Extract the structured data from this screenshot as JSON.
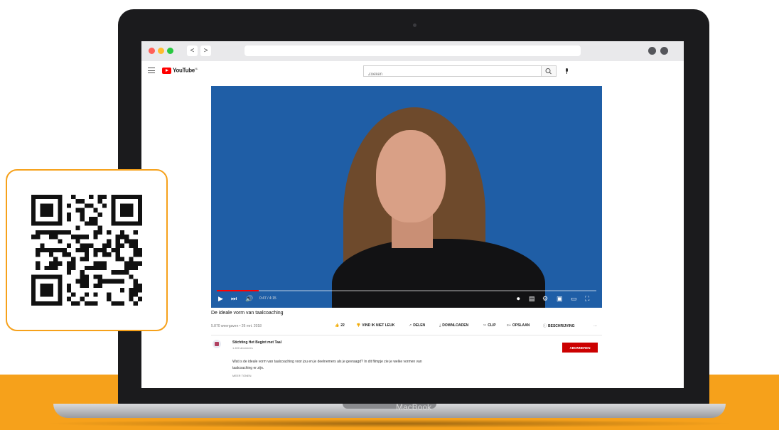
{
  "browser": {
    "traffic_lights": [
      "#ff5f57",
      "#febc2e",
      "#28c840"
    ],
    "back_label": "<",
    "forward_label": ">"
  },
  "youtube": {
    "logo_text": "YouTube",
    "logo_superscript": "NL",
    "search_placeholder": "Zoeken",
    "video": {
      "time": "0:47 / 4:15",
      "progress": 0.11
    },
    "title": "De ideale vorm van taalcoaching",
    "views": "5.870 weergaven • 26 mrt. 2018",
    "actions": [
      {
        "icon": "thumbs-up-icon",
        "glyph": "👍",
        "label": "22"
      },
      {
        "icon": "thumbs-down-icon",
        "glyph": "👎",
        "label": "VIND IK NIET LEUK"
      },
      {
        "icon": "share-icon",
        "glyph": "↗",
        "label": "DELEN"
      },
      {
        "icon": "download-icon",
        "glyph": "⤓",
        "label": "DOWNLOADEN"
      },
      {
        "icon": "clip-icon",
        "glyph": "✂",
        "label": "CLIP"
      },
      {
        "icon": "save-icon",
        "glyph": "≡+",
        "label": "OPSLAAN"
      },
      {
        "icon": "info-icon",
        "glyph": "ⓘ",
        "label": "BESCHRIJVING"
      },
      {
        "icon": "more-icon",
        "glyph": "…",
        "label": ""
      }
    ],
    "channel": {
      "name": "Stichting Het Begint met Taal",
      "subscribers": "1.400 abonnees",
      "subscribe_label": "ABONNEREN"
    },
    "description": "Wat is de ideale vorm van taalcoaching voor jou en je deelnemers als je gevraagd? In dit filmpje zie je welke vormen van taalcoaching er zijn.",
    "more_label": "MEER TONEN"
  },
  "device": {
    "brand": "MacBook"
  },
  "colors": {
    "accent_orange": "#f6a11b",
    "youtube_red": "#ff0000",
    "video_bg": "#1f5ea6"
  }
}
